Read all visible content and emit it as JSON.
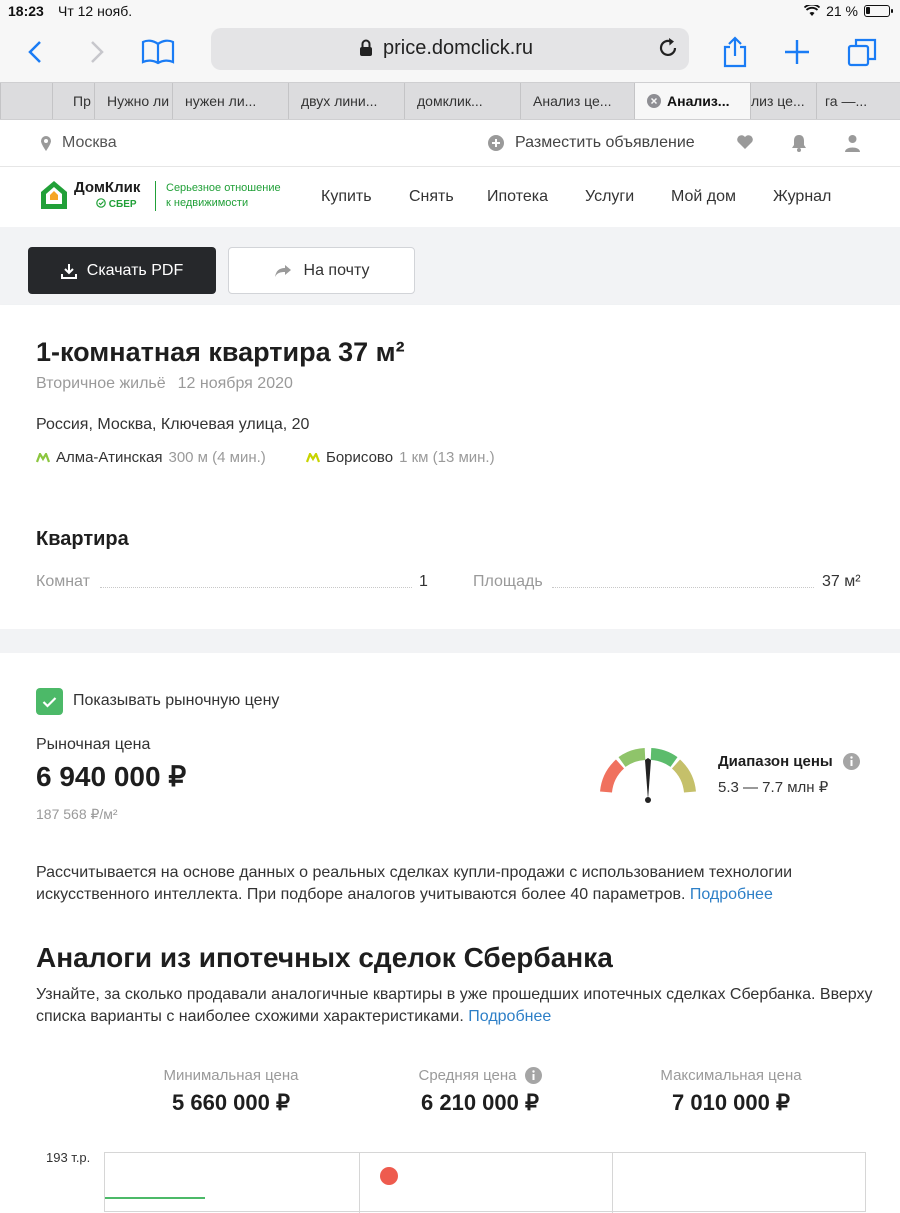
{
  "status_bar": {
    "time": "18:23",
    "date": "Чт 12 нояб.",
    "battery": "21 %",
    "battery_level": 0.21
  },
  "browser": {
    "url": "price.domclick.ru",
    "tabs": [
      {
        "title": "Пр"
      },
      {
        "title": "Нужно ли"
      },
      {
        "title": "нужен ли..."
      },
      {
        "title": "двух лини..."
      },
      {
        "title": "домклик..."
      },
      {
        "title": "Анализ це..."
      },
      {
        "title": "Анализ...",
        "active": true
      },
      {
        "title": "лиз це..."
      },
      {
        "title": "га —..."
      }
    ]
  },
  "site_top": {
    "city": "Москва",
    "post_ad": "Разместить объявление"
  },
  "logo": {
    "name": "ДомКлик",
    "sub": "СБЕР",
    "slogan_1": "Серьезное отношение",
    "slogan_2": "к недвижимости"
  },
  "nav": {
    "items": [
      "Купить",
      "Снять",
      "Ипотека",
      "Услуги",
      "Мой дом",
      "Журнал"
    ]
  },
  "actions": {
    "pdf": "Скачать PDF",
    "mail": "На почту"
  },
  "listing": {
    "title": "1-комнатная квартира 37 м²",
    "type": "Вторичное жильё",
    "date": "12 ноября 2020",
    "address": "Россия, Москва, Ключевая улица, 20",
    "metro": [
      {
        "name": "Алма-Атинская",
        "dist": "300 м (4 мин.)"
      },
      {
        "name": "Борисово",
        "dist": "1 км (13 мин.)"
      }
    ]
  },
  "apartment": {
    "heading": "Квартира",
    "rooms_label": "Комнат",
    "rooms_value": "1",
    "area_label": "Площадь",
    "area_value": "37 м²"
  },
  "market": {
    "checkbox_label": "Показывать рыночную цену",
    "checked": true,
    "label": "Рыночная цена",
    "value": "6 940 000 ₽",
    "per_m2": "187 568 ₽/м²",
    "range_title": "Диапазон цены",
    "range_value": "5.3 — 7.7 млн ₽",
    "description": "Рассчитывается на основе данных о реальных сделках купли-продажи с использованием технологии искусственного интеллекта. При подборе аналогов учитываются более 40 параметров.",
    "more": "Подробнее"
  },
  "analogs": {
    "heading": "Аналоги из ипотечных сделок Сбербанка",
    "description": "Узнайте, за сколько продавали аналогичные квартиры в уже прошедших ипотечных сделках Сбербанка. Вверху списка варианты с наиболее схожими характеристиками.",
    "more": "Подробнее",
    "min_label": "Минимальная цена",
    "min_value": "5 660 000 ₽",
    "avg_label": "Средняя цена",
    "avg_value": "6 210 000 ₽",
    "max_label": "Максимальная цена",
    "max_value": "7 010 000 ₽",
    "chart_top_label": "193 т.р."
  }
}
